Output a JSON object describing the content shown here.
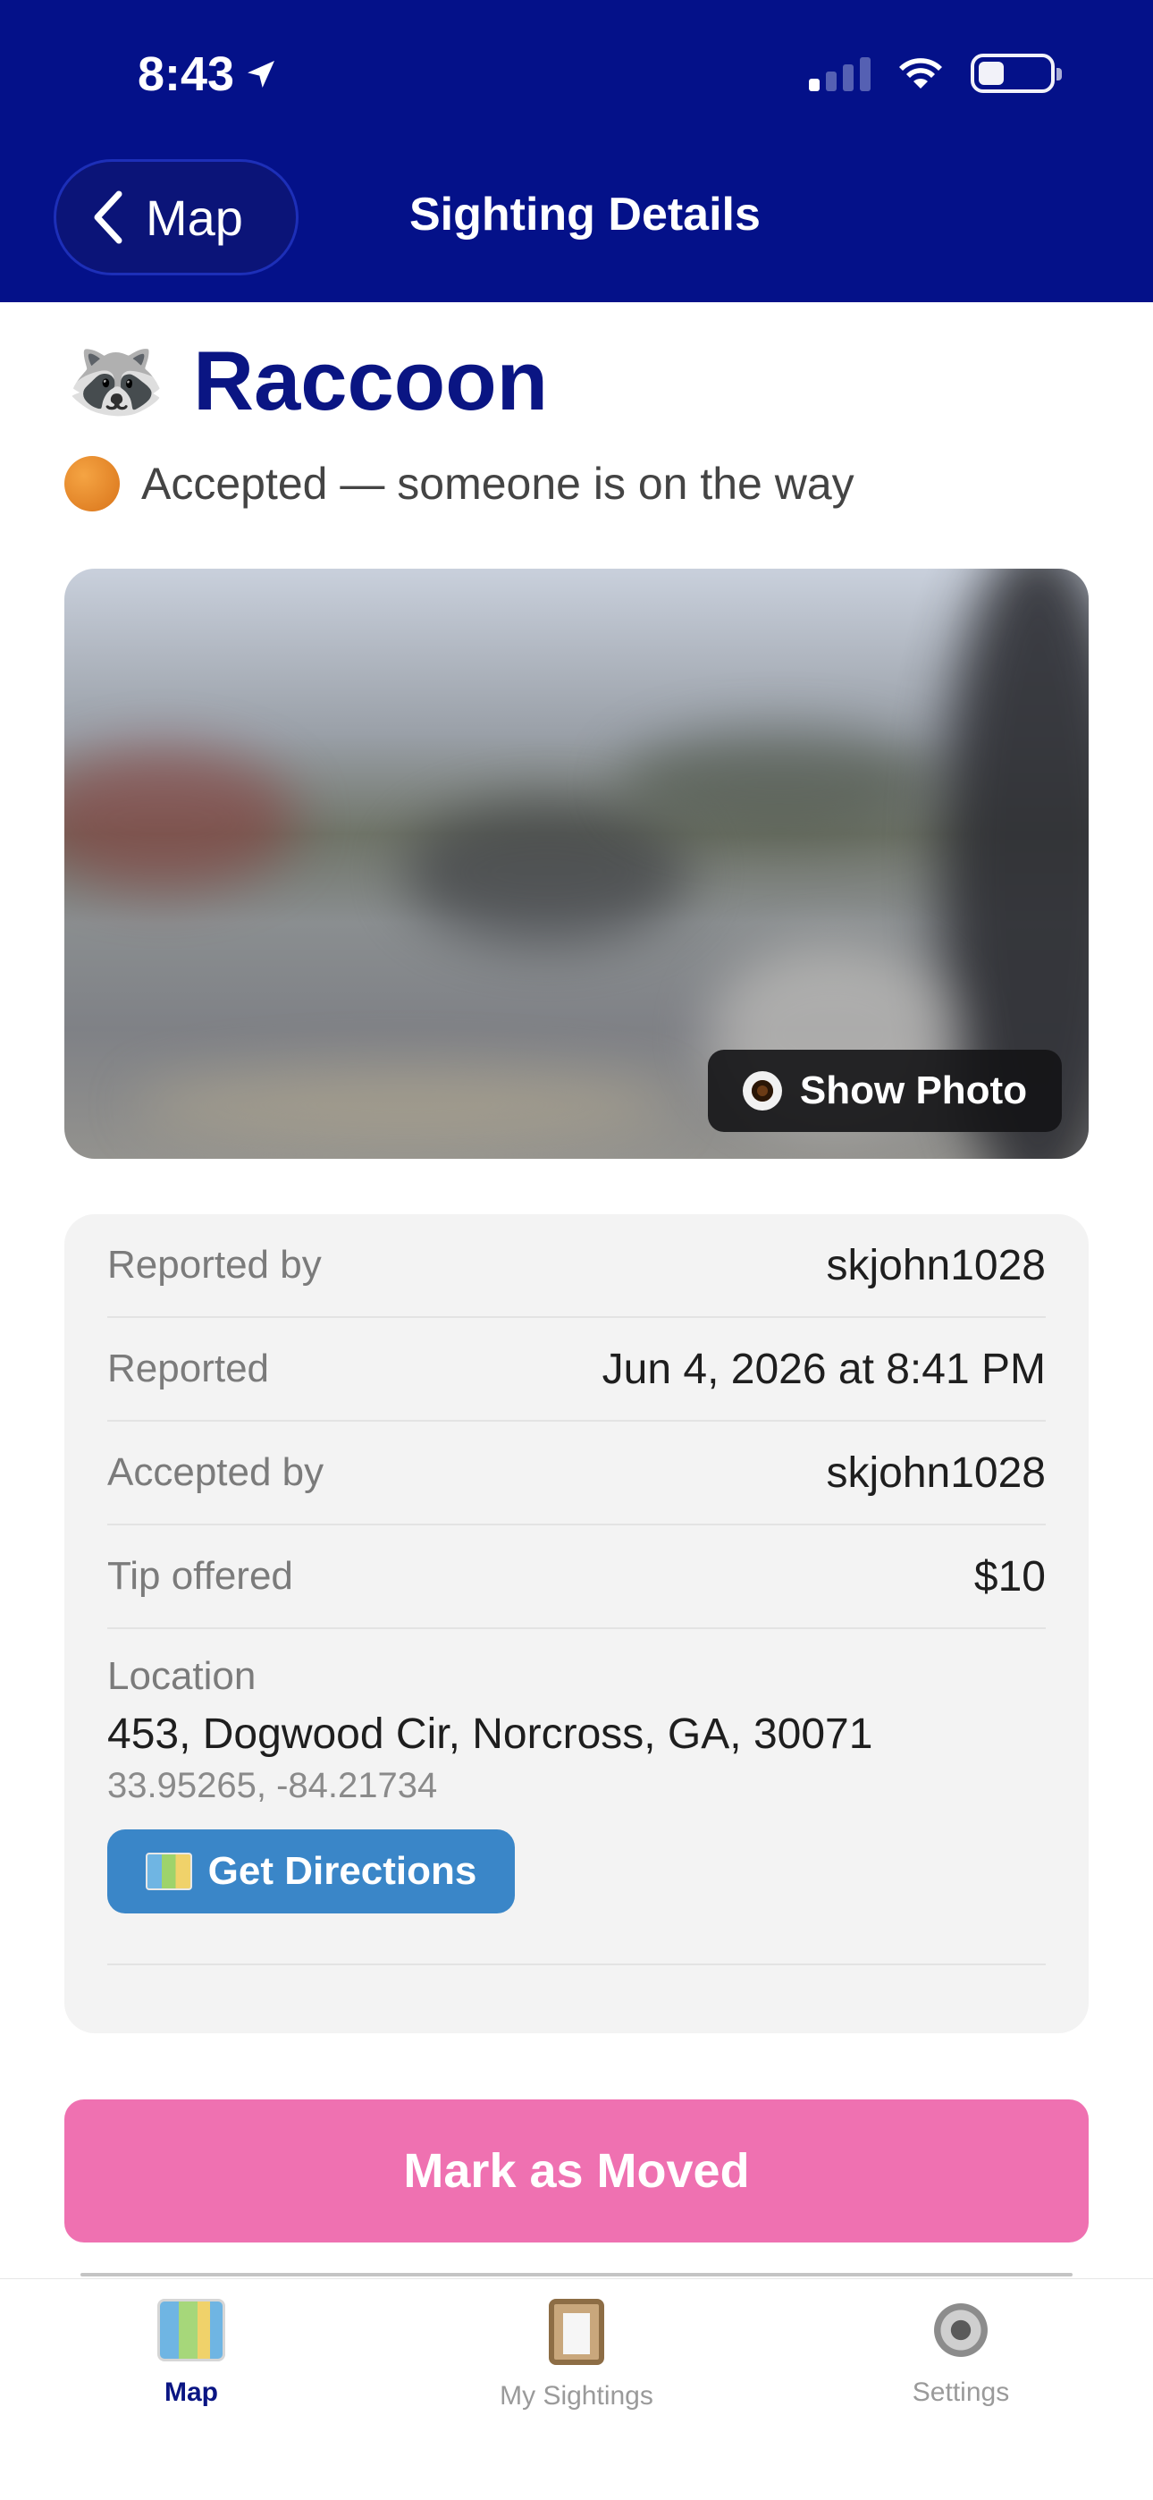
{
  "status_bar": {
    "time": "8:43"
  },
  "header": {
    "back_label": "Map",
    "title": "Sighting Details"
  },
  "sighting": {
    "emoji": "🦝",
    "name": "Raccoon",
    "status": "Accepted — someone is on the way",
    "photo_button": "Show Photo"
  },
  "details": {
    "reported_by_label": "Reported by",
    "reported_by": "skjohn1028",
    "reported_label": "Reported",
    "reported": "Jun 4, 2026 at 8:41 PM",
    "accepted_by_label": "Accepted by",
    "accepted_by": "skjohn1028",
    "tip_label": "Tip offered",
    "tip": "$10",
    "location_label": "Location",
    "address": "453, Dogwood Cir, Norcross, GA, 30071",
    "coords": "33.95265, -84.21734",
    "directions_button": "Get Directions"
  },
  "actions": {
    "mark_moved": "Mark as Moved"
  },
  "tabbar": {
    "items": [
      {
        "label": "Map",
        "icon": "map-icon",
        "active": true
      },
      {
        "label": "My Sightings",
        "icon": "clipboard-icon",
        "active": false
      },
      {
        "label": "Settings",
        "icon": "gear-icon",
        "active": false
      }
    ]
  },
  "colors": {
    "header_bg": "#041189",
    "title_color": "#0a1583",
    "status_orange": "#e8861f",
    "directions_blue": "#3a86c8",
    "mark_pink": "#ef71b1"
  }
}
